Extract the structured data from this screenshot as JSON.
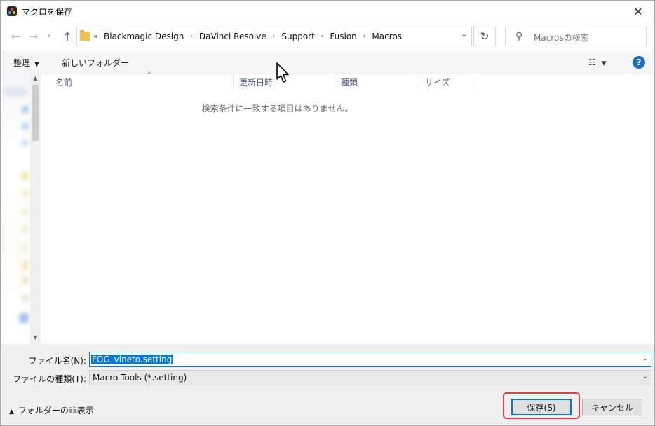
{
  "window": {
    "title": "マクロを保存",
    "close_glyph": "✕"
  },
  "nav": {
    "back_glyph": "←",
    "forward_glyph": "→",
    "recent_glyph": "▾",
    "up_glyph": "↑",
    "overflow_glyph": "«",
    "breadcrumbs": [
      "Blackmagic Design",
      "DaVinci Resolve",
      "Support",
      "Fusion",
      "Macros"
    ],
    "crumb_separator": "›",
    "dropdown_glyph": "⌄",
    "refresh_glyph": "↻",
    "search_placeholder": "Macrosの検索"
  },
  "toolbar": {
    "organize_label": "整理",
    "organize_caret": "▼",
    "new_folder_label": "新しいフォルダー",
    "view_glyph": "☷",
    "view_caret": "▼",
    "help_glyph": "?"
  },
  "filelist": {
    "sort_glyph": "^",
    "columns": {
      "name": "名前",
      "date": "更新日時",
      "type": "種類",
      "size": "サイズ"
    },
    "empty_message": "検索条件に一致する項目はありません。"
  },
  "form": {
    "filename_label": "ファイル名(N):",
    "filename_value": "FOG_vineto.setting",
    "filetype_label": "ファイルの種類(T):",
    "filetype_value": "Macro Tools (*.setting)",
    "dropdown_glyph": "⌄",
    "hide_folders_label": "フォルダーの非表示",
    "hide_folders_glyph": "▲",
    "save_label": "保存(S)",
    "cancel_label": "キャンセル"
  },
  "scrollbar": {
    "up_glyph": "▲",
    "down_glyph": "▼"
  },
  "colors": {
    "accent": "#0078d7",
    "highlight": "#e34040",
    "help": "#1e6fc4",
    "folder": "#f0c453"
  }
}
